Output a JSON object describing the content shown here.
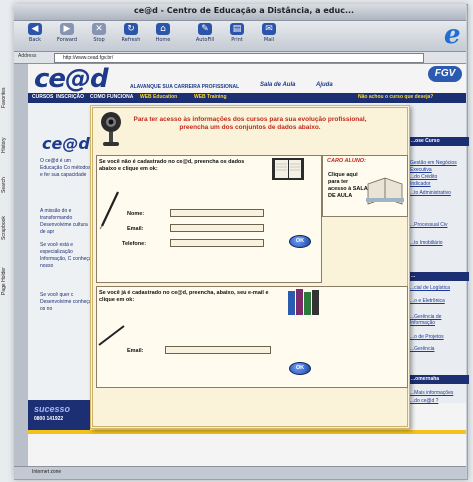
{
  "window": {
    "title": "ce@d - Centro de Educação a Distância, a educ..."
  },
  "toolbar": {
    "buttons": [
      {
        "label": "Back",
        "glyph": "◀"
      },
      {
        "label": "Forward",
        "glyph": "▶"
      },
      {
        "label": "Stop",
        "glyph": "✕"
      },
      {
        "label": "Refresh",
        "glyph": "↻"
      },
      {
        "label": "Home",
        "glyph": "⌂"
      },
      {
        "label": "AutoFill",
        "glyph": "✎"
      },
      {
        "label": "Print",
        "glyph": "▤"
      },
      {
        "label": "Mail",
        "glyph": "✉"
      }
    ],
    "browser_logo": "e"
  },
  "address": {
    "label": "Address",
    "url": "http://www.cead.fgv.br/"
  },
  "site": {
    "logo": "ce@d",
    "tagline": "ALAVANQUE SUA CARREIRA PROFISSIONAL",
    "sala_link": "Sala de Aula",
    "ajuda_link": "Ajuda",
    "fgv_logo": "FGV",
    "nav": [
      "CURSOS",
      "INSCRIÇÃO",
      "COMO FUNCIONA",
      "WEB Education",
      "WEB Training"
    ],
    "nav_question": "Não achou o curso que deseja?",
    "mini_logo": "ce@d",
    "left_texts": [
      "O ce@d é um Educação Co métodos e fer sua capacidade",
      "A missão do e transformando Desenvolvime cultura de apr",
      "Se você está e especialização Informação, C conheça nosso",
      "Se você quer c Desenvolvime conheça os no"
    ],
    "right_head_1": "...ose Curso",
    "right_links_1": [
      "Gestão em Negócios",
      "Executiva",
      "...do Crédito",
      "Indicador",
      "...to Administrativo",
      "...Processual Civ",
      "...to Imobiliário"
    ],
    "right_head_2": "...",
    "right_links_2": [
      "...cial de Logística",
      "...o e Eletrônica",
      "...Gerência de Informação",
      "...o de Projetos",
      "...Gerência"
    ],
    "right_bottom": [
      "...omernaha",
      "...Mais informações",
      "...do ce@d ?"
    ],
    "sucesso": "sucesso",
    "phone": "0800 141922",
    "sidebar_tabs": [
      "Favorites",
      "History",
      "Search",
      "Scrapbook",
      "Page Holder"
    ],
    "status": "Internet zone"
  },
  "popup": {
    "title": "Para ter acesso às informações dos cursos para sua evolução profissional, preencha um dos conjuntos de dados abaixo.",
    "new_user": {
      "instructions": "Se você não é cadastrado no ce@d, preencha os dados abaixo e clique em ok:",
      "name_label": "Nome:",
      "email_label": "Email:",
      "phone_label": "Telefone:",
      "ok": "OK"
    },
    "existing_user": {
      "instructions": "Se você já é cadastrado no ce@d, preencha, abaixo, seu e-mail e clique em ok:",
      "email_label": "Email:",
      "ok": "OK"
    },
    "caro_aluno": {
      "title": "CARO ALUNO:",
      "text": "Clique aqui para ter acesso à SALA DE AULA"
    }
  }
}
